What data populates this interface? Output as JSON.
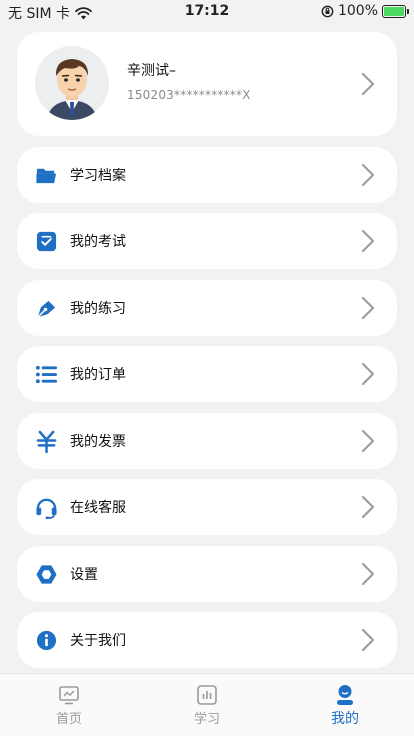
{
  "status_bar": {
    "carrier": "无 SIM 卡",
    "time": "17:12",
    "battery_percent": "100%",
    "battery_level": 1.0
  },
  "profile": {
    "name": "辛测试–",
    "id_number": "150203***********X"
  },
  "menu": [
    {
      "label": "学习档案",
      "icon": "folder-icon"
    },
    {
      "label": "我的考试",
      "icon": "exam-check-icon"
    },
    {
      "label": "我的练习",
      "icon": "pen-nib-icon"
    },
    {
      "label": "我的订单",
      "icon": "list-icon"
    },
    {
      "label": "我的发票",
      "icon": "yuan-icon"
    },
    {
      "label": "在线客服",
      "icon": "headset-icon"
    },
    {
      "label": "设置",
      "icon": "gear-hexagon-icon"
    },
    {
      "label": "关于我们",
      "icon": "info-icon"
    }
  ],
  "tabbar": [
    {
      "label": "首页",
      "icon": "home-monitor-icon",
      "active": false
    },
    {
      "label": "学习",
      "icon": "study-chart-icon",
      "active": false
    },
    {
      "label": "我的",
      "icon": "profile-icon",
      "active": true
    }
  ],
  "colors": {
    "accent": "#1f6fc5",
    "background": "#f2f2f2",
    "card": "#ffffff",
    "chevron": "#9e9e9e"
  }
}
